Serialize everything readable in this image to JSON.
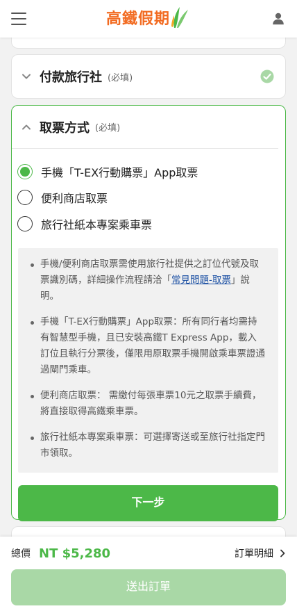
{
  "header": {
    "logo_text": "高鐵假期",
    "menu_icon": "hamburger-menu-icon",
    "user_icon": "user-icon"
  },
  "payment_section": {
    "title": "付款旅行社",
    "required": "(必填)",
    "status_icon": "check-circle-icon",
    "completed": true
  },
  "ticket_section": {
    "title": "取票方式",
    "required": "(必填)",
    "options": [
      {
        "label": "手機「T-EX行動購票」App取票",
        "selected": true
      },
      {
        "label": "便利商店取票",
        "selected": false
      },
      {
        "label": "旅行社紙本專案乘車票",
        "selected": false
      }
    ],
    "notes": {
      "note1_before": "手機/便利商店取票需使用旅行社提供之訂位代號及取票識別碼，詳細操作流程請洽「",
      "note1_link": "常見問題-取票",
      "note1_after": "」說明。",
      "note2": "手機「T-EX行動購票」App取票：所有同行者均需持有智慧型手機，且已安裝高鐵T Express App，載入訂位且執行分票後，僅限用原取票手機開啟乘車票證通過閘門乘車。",
      "note3": "便利商店取票： 需繳付每張車票10元之取票手續費，將直接取得高鐵乘車票。",
      "note4": "旅行社紙本專案乘車票：可選擇寄送或至旅行社指定門市領取。"
    },
    "next_button": "下一步"
  },
  "footer": {
    "total_label": "總價",
    "total_value": "NT $5,280",
    "order_detail": "訂單明細",
    "submit_button": "送出訂單"
  },
  "colors": {
    "brand_orange": "#f26b21",
    "accent_green": "#4cb848",
    "disabled_green": "#a9d8a6",
    "link_blue": "#1a4fa3"
  }
}
